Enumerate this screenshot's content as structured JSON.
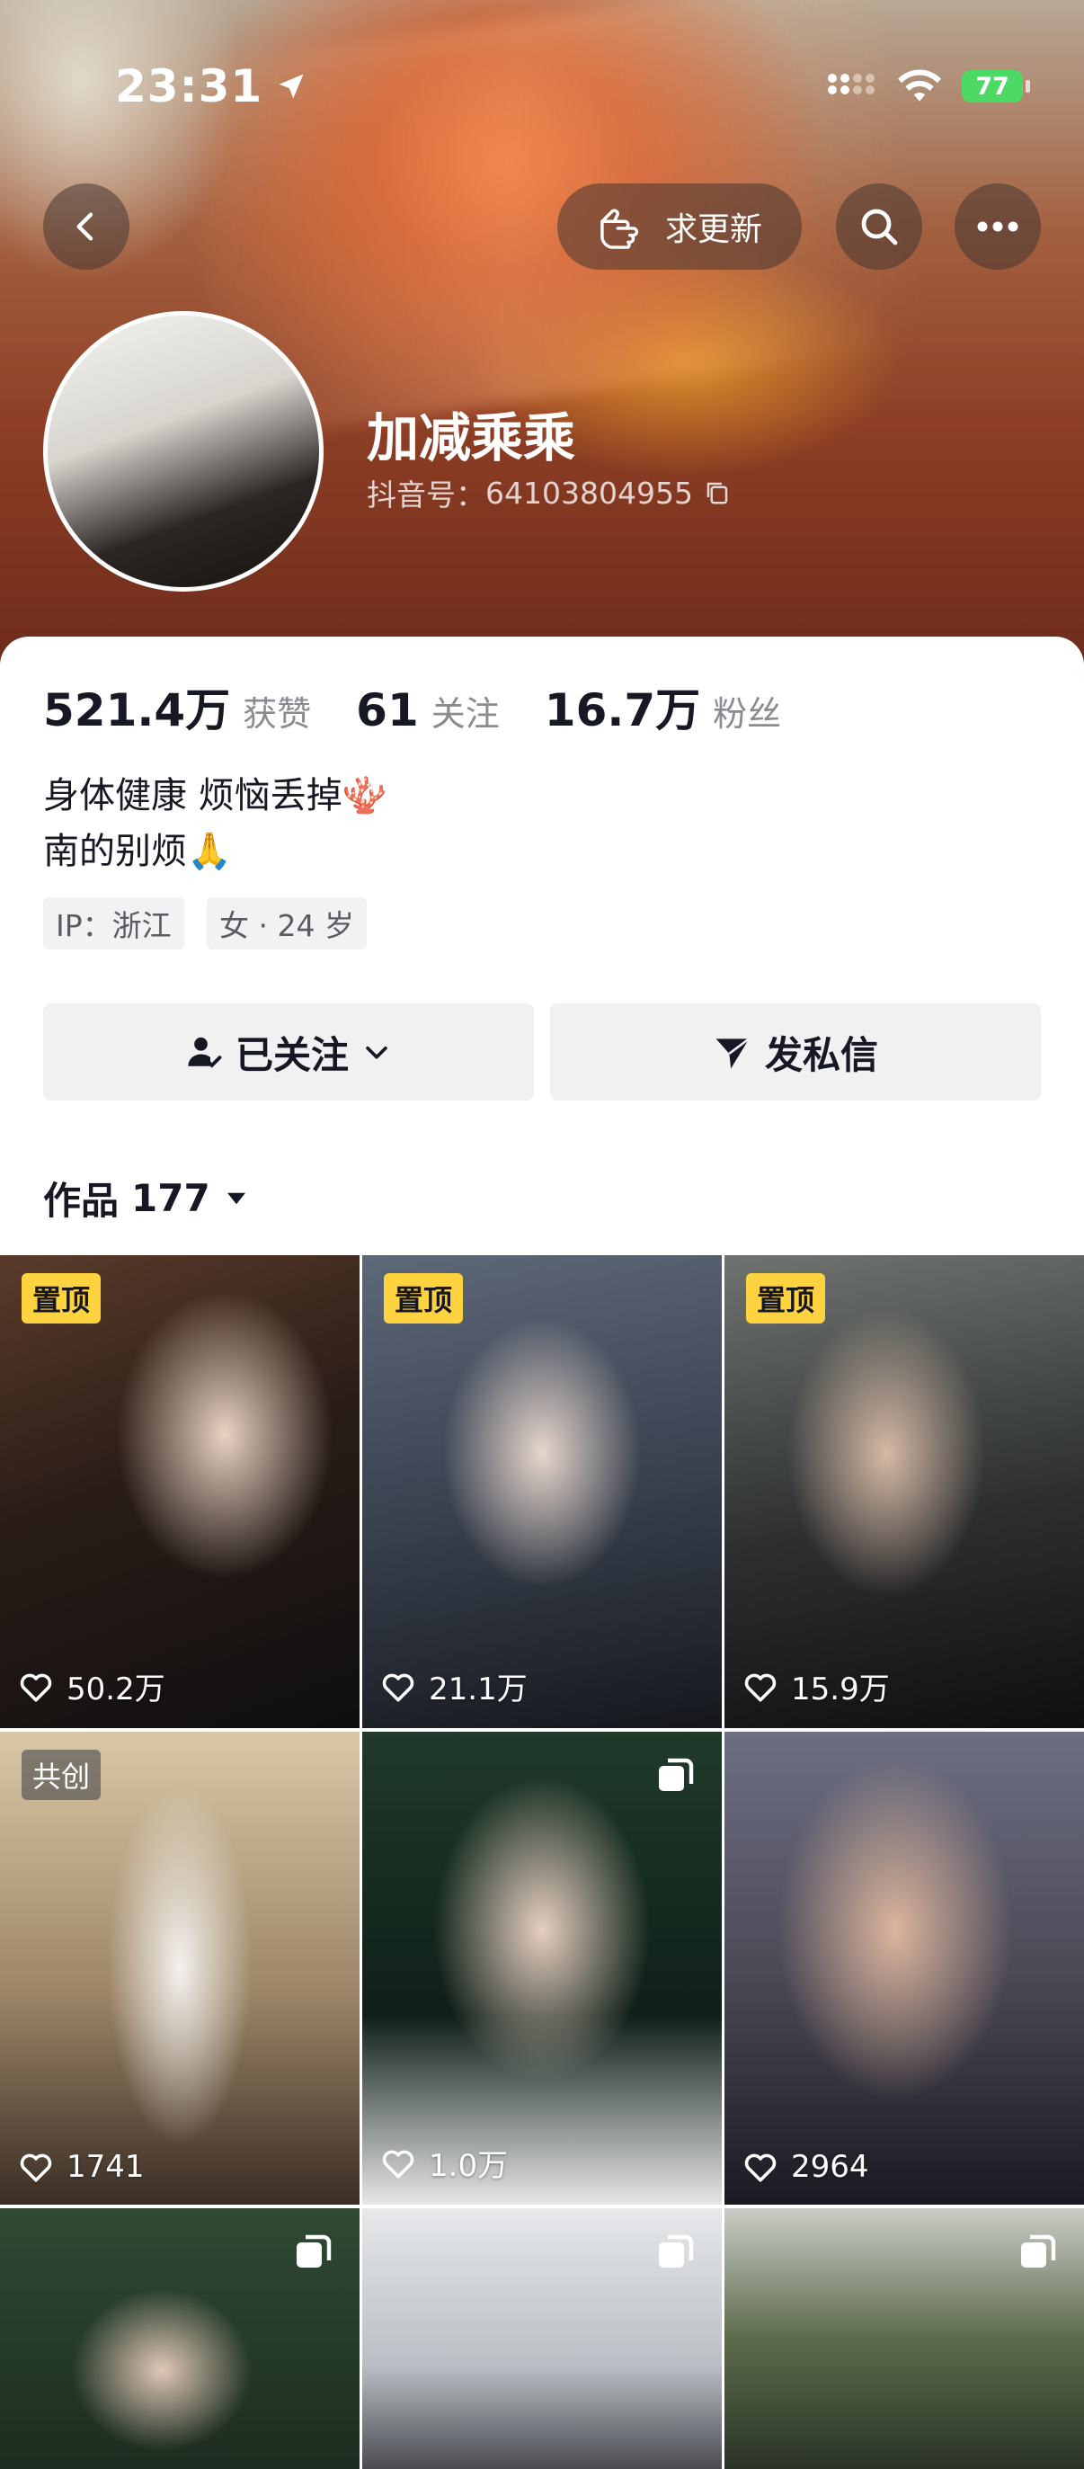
{
  "status_bar": {
    "time": "23:31",
    "battery": "77"
  },
  "header": {
    "update_label": "求更新"
  },
  "profile": {
    "name": "加减乘乘",
    "douyin_id_label": "抖音号：",
    "douyin_id": "64103804955"
  },
  "stats": [
    {
      "value": "521.4万",
      "label": "获赞"
    },
    {
      "value": "61",
      "label": "关注"
    },
    {
      "value": "16.7万",
      "label": "粉丝"
    }
  ],
  "bio": {
    "line1": "身体健康 烦恼丢掉🪸",
    "line2": "南的别烦🙏"
  },
  "tags": {
    "ip": "IP：浙江",
    "info": "女 · 24 岁"
  },
  "actions": {
    "follow_label": "已关注",
    "message_label": "发私信"
  },
  "works": {
    "label": "作品",
    "count": "177"
  },
  "grid": [
    {
      "badge": "置顶",
      "likes": "50.2万"
    },
    {
      "badge": "置顶",
      "likes": "21.1万"
    },
    {
      "badge": "置顶",
      "likes": "15.9万"
    },
    {
      "badge": "共创",
      "likes": "1741"
    },
    {
      "likes": "1.0万",
      "icon": "multi-image-icon"
    },
    {
      "likes": "2964"
    },
    {
      "icon": "multi-image-icon"
    },
    {
      "icon": "multi-image-icon"
    },
    {
      "icon": "multi-image-icon"
    }
  ],
  "colors": {
    "pin_badge": "#ffd23f",
    "battery": "#4cd964",
    "text_primary": "#161823",
    "text_secondary": "#8a8b91"
  }
}
